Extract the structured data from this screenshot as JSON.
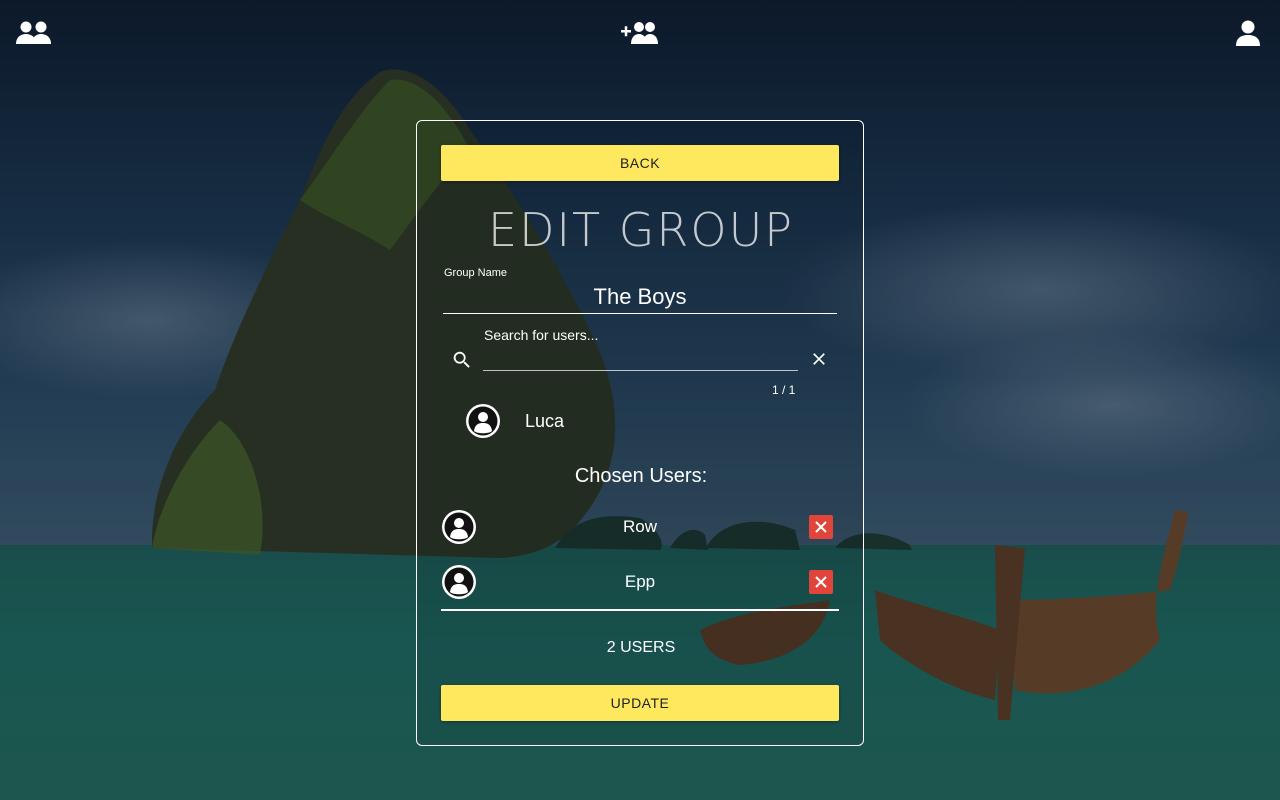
{
  "nav": {
    "groups_icon": "groups-icon",
    "add_group_icon": "add-group-icon",
    "profile_icon": "profile-icon"
  },
  "panel": {
    "back_label": "BACK",
    "title": "EDIT GROUP",
    "group_name_label": "Group Name",
    "group_name_value": "The Boys",
    "search_label": "Search for users...",
    "search_value": "",
    "page_count": "1 / 1",
    "search_results": [
      {
        "name": "Luca"
      }
    ],
    "chosen_heading": "Chosen Users:",
    "chosen_users": [
      {
        "name": "Row"
      },
      {
        "name": "Epp"
      }
    ],
    "user_count": "2 USERS",
    "update_label": "UPDATE"
  },
  "colors": {
    "accent_yellow": "#fde85e",
    "remove_red": "#e0443a"
  }
}
